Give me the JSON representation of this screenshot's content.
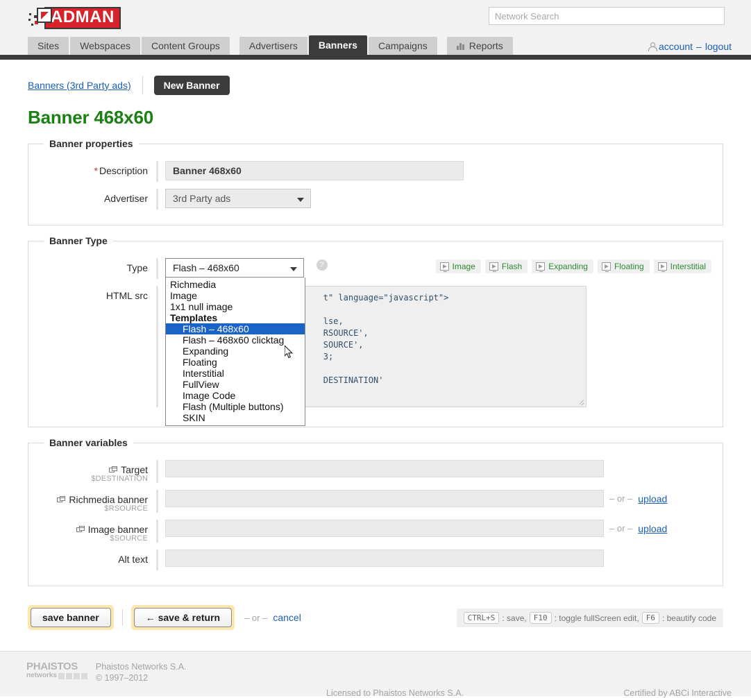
{
  "header": {
    "logo_text": "ADMAN",
    "search_placeholder": "Network Search",
    "account_label": "account",
    "account_sep": "–",
    "logout_label": "logout"
  },
  "nav": {
    "tabs": [
      {
        "label": "Sites",
        "active": false,
        "icon": null
      },
      {
        "label": "Webspaces",
        "active": false,
        "icon": null
      },
      {
        "label": "Content Groups",
        "active": false,
        "icon": null
      },
      {
        "label": "Advertisers",
        "active": false,
        "icon": null
      },
      {
        "label": "Banners",
        "active": true,
        "icon": null
      },
      {
        "label": "Campaigns",
        "active": false,
        "icon": null
      },
      {
        "label": "Reports",
        "active": false,
        "icon": "bar-chart-icon"
      }
    ]
  },
  "crumb": {
    "link": "Banners (3rd Party ads)",
    "new_button": "New Banner"
  },
  "page_title": "Banner 468x60",
  "banner_properties": {
    "legend": "Banner properties",
    "description_label": "Description",
    "description_required": "*",
    "description_value": "Banner 468x60",
    "advertiser_label": "Advertiser",
    "advertiser_value": "3rd Party ads"
  },
  "banner_type": {
    "legend": "Banner Type",
    "type_label": "Type",
    "type_value": "Flash – 468x60",
    "help_glyph": "?",
    "html_src_label": "HTML src",
    "dropdown_open": true,
    "dropdown_options": [
      {
        "label": "Richmedia",
        "group": false,
        "indent": false,
        "selected": false
      },
      {
        "label": "Image",
        "group": false,
        "indent": false,
        "selected": false
      },
      {
        "label": "1x1 null image",
        "group": false,
        "indent": false,
        "selected": false
      },
      {
        "label": "Templates",
        "group": true,
        "indent": false,
        "selected": false
      },
      {
        "label": "Flash – 468x60",
        "group": false,
        "indent": true,
        "selected": true
      },
      {
        "label": "Flash – 468x60 clicktag",
        "group": false,
        "indent": true,
        "selected": false
      },
      {
        "label": "Expanding",
        "group": false,
        "indent": true,
        "selected": false
      },
      {
        "label": "Floating",
        "group": false,
        "indent": true,
        "selected": false
      },
      {
        "label": "Interstitial",
        "group": false,
        "indent": true,
        "selected": false
      },
      {
        "label": "FullView",
        "group": false,
        "indent": true,
        "selected": false
      },
      {
        "label": "Image Code",
        "group": false,
        "indent": true,
        "selected": false
      },
      {
        "label": "Flash (Multiple buttons)",
        "group": false,
        "indent": true,
        "selected": false
      },
      {
        "label": "SKIN",
        "group": false,
        "indent": true,
        "selected": false
      }
    ],
    "template_chips": [
      {
        "label": "Image",
        "icon": "monitor-icon"
      },
      {
        "label": "Flash",
        "icon": "monitor-icon"
      },
      {
        "label": "Expanding",
        "icon": "monitor-icon"
      },
      {
        "label": "Floating",
        "icon": "monitor-icon"
      },
      {
        "label": "Interstitial",
        "icon": "monitor-icon"
      }
    ],
    "html_src_value": "                              t\" language=\"javascript\">\n\n                              lse,\n                              RSOURCE',\n                              SOURCE',\n                              3;\n\n                              DESTINATION'"
  },
  "banner_variables": {
    "legend": "Banner variables",
    "rows": [
      {
        "label": "Target",
        "var": "$DESTINATION",
        "icon": "window-link-icon",
        "value": "",
        "upload": null
      },
      {
        "label": "Richmedia banner",
        "var": "$RSOURCE",
        "icon": "window-link-icon",
        "value": "",
        "upload": "upload",
        "or": "– or –"
      },
      {
        "label": "Image banner",
        "var": "$SOURCE",
        "icon": "window-link-icon",
        "value": "",
        "upload": "upload",
        "or": "– or –"
      },
      {
        "label": "Alt text",
        "var": "",
        "icon": null,
        "value": "",
        "upload": null
      }
    ]
  },
  "actions": {
    "save_banner": "save banner",
    "save_return": "← save & return",
    "or": "– or –",
    "cancel": "cancel",
    "hints": {
      "key1": "CTRL+S",
      "text1": ": save,",
      "key2": "F10",
      "text2": ": toggle fullScreen edit,",
      "key3": "F6",
      "text3": ": beautify code"
    }
  },
  "footer": {
    "logo_top": "PHAISTOS",
    "logo_bottom": "networks",
    "company": "Phaistos Networks S.A.",
    "copyright": "© 1997–2012",
    "license": "Licensed to Phaistos Networks S.A.",
    "certified": "Certified by ABCi Interactive"
  },
  "colors": {
    "brand_red": "#d8232a",
    "nav_dark": "#3b3b3b",
    "title_green": "#1a8011",
    "link_blue": "#1a5fb4",
    "select_blue": "#1a64c8",
    "highlight_yellow": "#fde7b0"
  }
}
